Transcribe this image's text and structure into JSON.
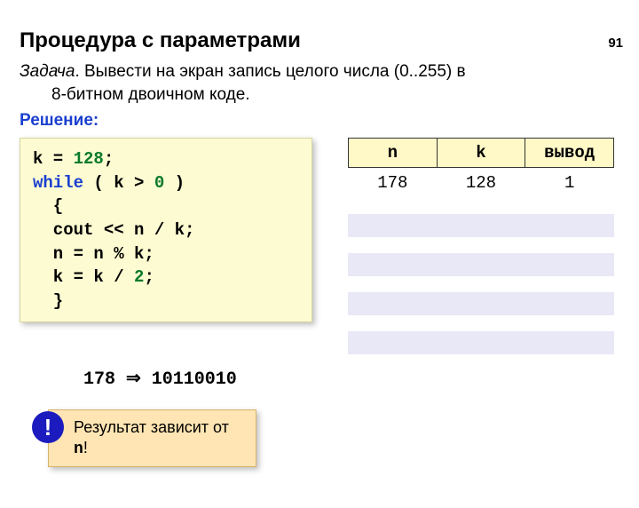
{
  "page_number": "91",
  "title": "Процедура с параметрами",
  "task": {
    "label": "Задача",
    "text_line1": ". Вывести на экран запись целого числа (0..255) в",
    "text_line2": "8-битном двоичном коде."
  },
  "solution_label": "Решение:",
  "code": {
    "l1a": "k = ",
    "l1b": "128",
    "l1c": ";",
    "l2a": "while",
    "l2b": " ( k > ",
    "l2c": "0",
    "l2d": " )",
    "l3": "  {",
    "l4": "  cout << n / k;",
    "l5": "  n = n % k;",
    "l6a": "  k = k / ",
    "l6b": "2",
    "l6c": ";",
    "l7": "  }"
  },
  "table": {
    "headers": {
      "n": "n",
      "k": "k",
      "out": "вывод"
    },
    "row1": {
      "n": "178",
      "k": "128",
      "out": "1"
    }
  },
  "conversion": {
    "input": "178",
    "arrow": " ⇒ ",
    "output": "10110010"
  },
  "note": {
    "bang": "!",
    "text_a": "Результат зависит от ",
    "text_b": "n",
    "text_c": "!"
  }
}
